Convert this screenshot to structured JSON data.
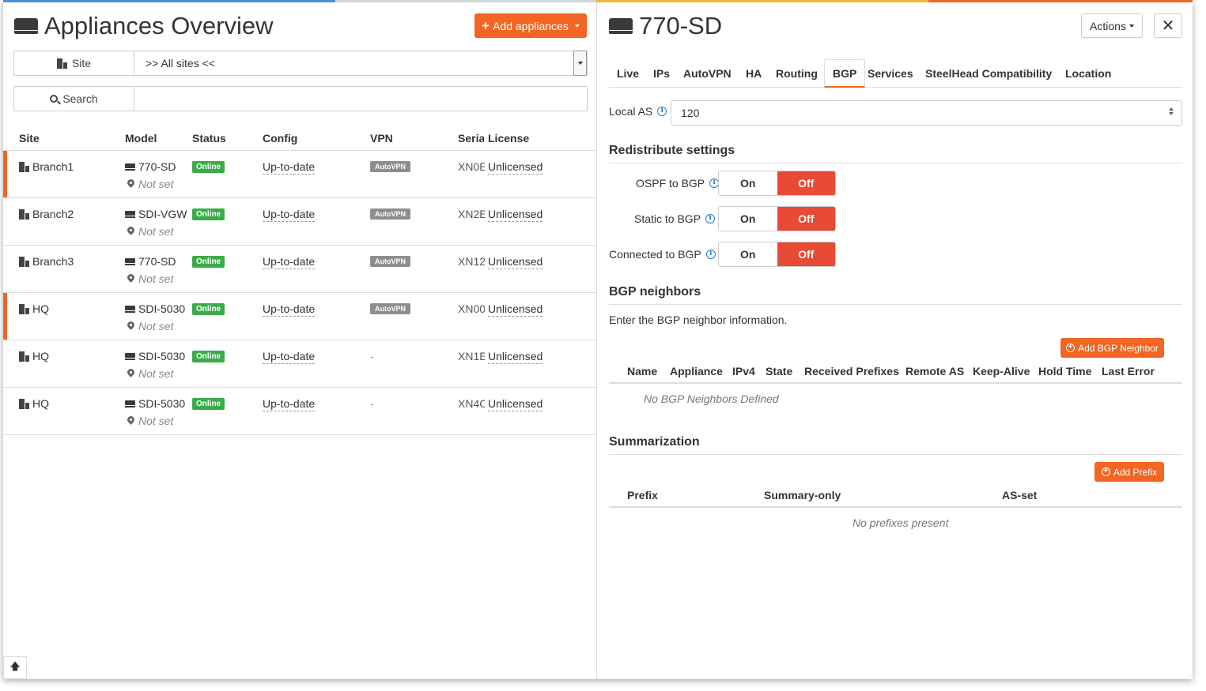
{
  "left": {
    "title": "Appliances Overview",
    "add_button": "Add appliances",
    "site_filter": {
      "label": "Site",
      "value": ">> All sites <<"
    },
    "search_filter": {
      "label": "Search",
      "value": ""
    },
    "columns": [
      "Site",
      "Model",
      "Status",
      "Config",
      "VPN",
      "Serial",
      "License"
    ],
    "rows": [
      {
        "site": "Branch1",
        "model": "770-SD",
        "location": "Not set",
        "status": "Online",
        "config": "Up-to-date",
        "vpn": "AutoVPN",
        "serial": "XN0E",
        "license": "Unlicensed",
        "selected": true
      },
      {
        "site": "Branch2",
        "model": "SDI-VGW",
        "location": "Not set",
        "status": "Online",
        "config": "Up-to-date",
        "vpn": "AutoVPN",
        "serial": "XN2E",
        "license": "Unlicensed",
        "selected": false
      },
      {
        "site": "Branch3",
        "model": "770-SD",
        "location": "Not set",
        "status": "Online",
        "config": "Up-to-date",
        "vpn": "AutoVPN",
        "serial": "XN12",
        "license": "Unlicensed",
        "selected": false
      },
      {
        "site": "HQ",
        "model": "SDI-5030",
        "location": "Not set",
        "status": "Online",
        "config": "Up-to-date",
        "vpn": "AutoVPN",
        "serial": "XN00",
        "license": "Unlicensed",
        "selected": true
      },
      {
        "site": "HQ",
        "model": "SDI-5030",
        "location": "Not set",
        "status": "Online",
        "config": "Up-to-date",
        "vpn": "-",
        "serial": "XN1E",
        "license": "Unlicensed",
        "selected": false
      },
      {
        "site": "HQ",
        "model": "SDI-5030",
        "location": "Not set",
        "status": "Online",
        "config": "Up-to-date",
        "vpn": "-",
        "serial": "XN4C",
        "license": "Unlicensed",
        "selected": false
      }
    ]
  },
  "right": {
    "title": "770-SD",
    "actions_button": "Actions",
    "tabs": [
      "Live",
      "IPs",
      "AutoVPN",
      "HA",
      "Routing",
      "BGP",
      "Services",
      "SteelHead Compatibility",
      "Location"
    ],
    "active_tab": "BGP",
    "local_as": {
      "label": "Local AS",
      "value": "120"
    },
    "redistribute": {
      "title": "Redistribute settings",
      "items": [
        {
          "label": "OSPF to BGP",
          "on": "On",
          "off": "Off"
        },
        {
          "label": "Static to BGP",
          "on": "On",
          "off": "Off"
        },
        {
          "label": "Connected to BGP",
          "on": "On",
          "off": "Off"
        }
      ]
    },
    "neighbors": {
      "title": "BGP neighbors",
      "description": "Enter the BGP neighbor information.",
      "add_button": "Add BGP Neighbor",
      "columns": [
        "Name",
        "Appliance",
        "IPv4",
        "State",
        "Received Prefixes",
        "Remote AS",
        "Keep-Alive",
        "Hold Time",
        "Last Error"
      ],
      "empty": "No BGP Neighbors Defined"
    },
    "summarization": {
      "title": "Summarization",
      "add_button": "Add Prefix",
      "columns": [
        "Prefix",
        "Summary-only",
        "AS-set"
      ],
      "empty": "No prefixes present"
    }
  },
  "colors": {
    "accent": "#f26522",
    "off": "#e94a35",
    "online": "#3bab4a",
    "vpn_badge": "#8e8e8e",
    "info": "#2a7bc6"
  }
}
